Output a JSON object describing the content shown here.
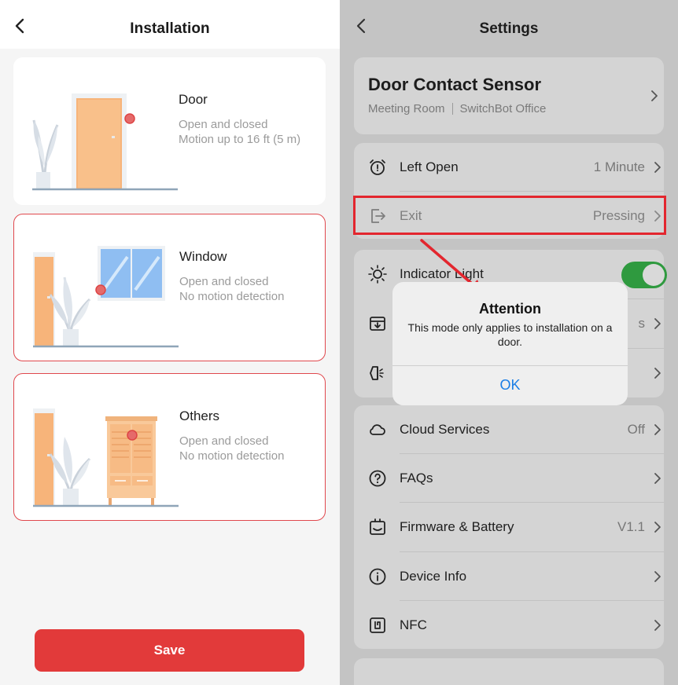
{
  "installation": {
    "title": "Installation",
    "options": [
      {
        "title": "Door",
        "line1": "Open and closed",
        "line2": "Motion up to 16 ft (5 m)"
      },
      {
        "title": "Window",
        "line1": "Open and closed",
        "line2": "No motion detection"
      },
      {
        "title": "Others",
        "line1": "Open and closed",
        "line2": "No motion detection"
      }
    ],
    "save_label": "Save"
  },
  "settings": {
    "title": "Settings",
    "device": {
      "name": "Door Contact Sensor",
      "room": "Meeting Room",
      "location": "SwitchBot Office"
    },
    "left_open": {
      "label": "Left Open",
      "value": "1 Minute",
      "icon": "alarm-clock-icon"
    },
    "exit": {
      "label": "Exit",
      "value": "Pressing",
      "icon": "exit-icon"
    },
    "indicator_light": {
      "label": "Indicator Light",
      "enabled": true,
      "icon": "sun-icon"
    },
    "hidden_row_1": {
      "value": "s",
      "icon": "download-box-icon"
    },
    "hidden_row_2": {
      "icon": "brightness-icon"
    },
    "cloud_services": {
      "label": "Cloud Services",
      "value": "Off",
      "icon": "cloud-icon"
    },
    "faqs": {
      "label": "FAQs",
      "icon": "question-icon"
    },
    "firmware": {
      "label": "Firmware & Battery",
      "value": "V1.1",
      "icon": "firmware-icon"
    },
    "device_info": {
      "label": "Device Info",
      "icon": "info-icon"
    },
    "nfc": {
      "label": "NFC",
      "icon": "nfc-icon"
    }
  },
  "dialog": {
    "title": "Attention",
    "message": "This mode only applies to installation on a door.",
    "ok_label": "OK"
  },
  "colors": {
    "accent_red": "#e23a3a",
    "toggle_green": "#2f9a3f",
    "link_blue": "#1a7ee6",
    "highlight": "#e3262e"
  }
}
